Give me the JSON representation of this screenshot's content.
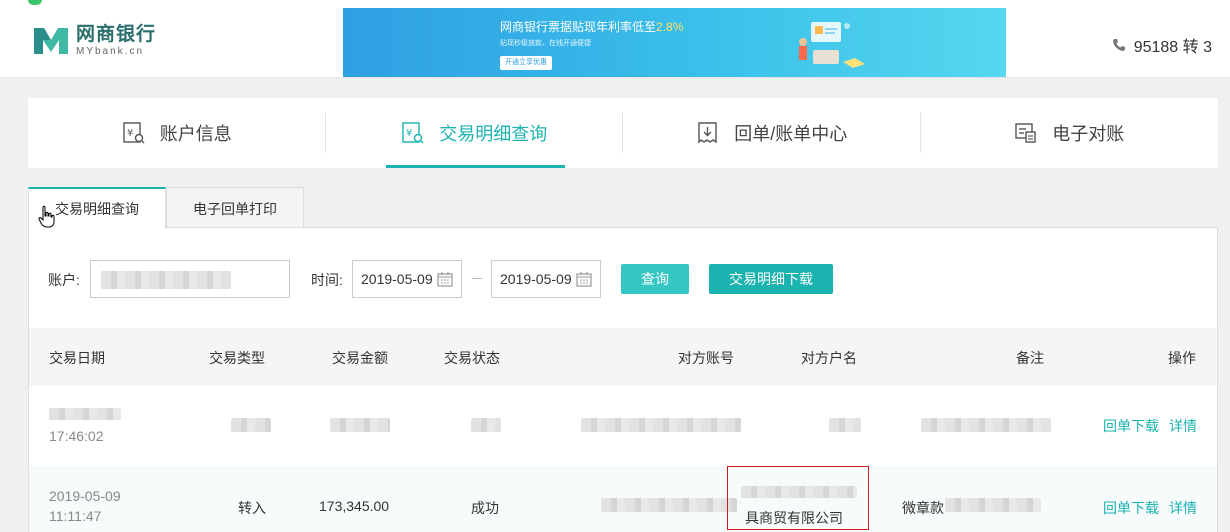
{
  "header": {
    "logo_cn": "网商银行",
    "logo_en": "MYbank.cn",
    "banner": {
      "title_prefix": "网商银行票据贴现年利率低至",
      "title_rate": "2.8%",
      "subtitle": "贴现秒级放款、在线开通便捷",
      "button": "开通立享优惠"
    },
    "phone": "95188 转 3"
  },
  "main_nav": [
    {
      "label": "账户信息",
      "icon": "account-info-icon"
    },
    {
      "label": "交易明细查询",
      "icon": "transaction-query-icon",
      "active": true
    },
    {
      "label": "回单/账单中心",
      "icon": "receipt-center-icon"
    },
    {
      "label": "电子对账",
      "icon": "e-reconcile-icon"
    }
  ],
  "sub_tabs": [
    {
      "label": "交易明细查询",
      "active": true
    },
    {
      "label": "电子回单打印"
    }
  ],
  "filters": {
    "account_label": "账户:",
    "time_label": "时间:",
    "date_from": "2019-05-09",
    "date_to": "2019-05-09",
    "query_button": "查询",
    "download_button": "交易明细下载"
  },
  "table": {
    "headers": [
      "交易日期",
      "交易类型",
      "交易金额",
      "交易状态",
      "对方账号",
      "对方户名",
      "备注",
      "操作"
    ],
    "rows": [
      {
        "date": "",
        "time": "17:46:02",
        "type": "",
        "amount": "",
        "status": "",
        "account": "",
        "name": "",
        "remark": "",
        "action_receipt": "回单下载",
        "action_detail": "详情"
      },
      {
        "date": "2019-05-09",
        "time": "11:11:47",
        "type": "转入",
        "amount": "173,345.00",
        "status": "成功",
        "account": "",
        "name": "具商贸有限公司",
        "remark": "微章款",
        "action_receipt": "回单下载",
        "action_detail": "详情"
      }
    ]
  },
  "colors": {
    "accent": "#1ab3b0",
    "highlight_box": "#d0191b"
  }
}
